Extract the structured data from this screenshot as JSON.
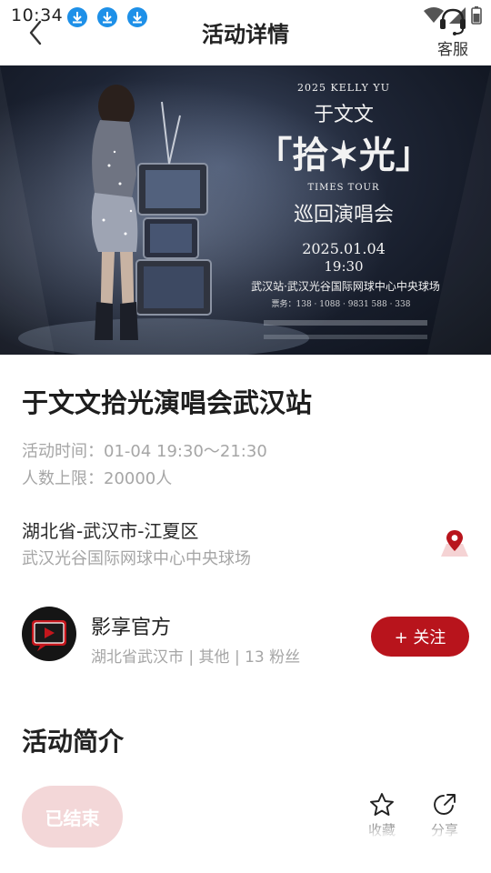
{
  "status_bar": {
    "time": "10:34"
  },
  "header": {
    "title": "活动详情",
    "service_label": "客服"
  },
  "poster": {
    "line1": "2025 KELLY YU",
    "line2": "于文文",
    "line3": "「拾✶光」",
    "line4": "TIMES TOUR",
    "line5": "巡回演唱会",
    "date": "2025.01.04",
    "time": "19:30",
    "venue": "武汉站·武汉光谷国际网球中心中央球场",
    "hotline": "票务：138 · 1088 · 9831 588 · 338"
  },
  "event": {
    "title": "于文文拾光演唱会武汉站",
    "time_line": "活动时间：01-04 19:30～21:30",
    "limit_line": "人数上限：20000人",
    "region": "湖北省-武汉市-江夏区",
    "venue": "武汉光谷国际网球中心中央球场"
  },
  "organizer": {
    "name": "影享官方",
    "meta": "湖北省武汉市 | 其他 | 13 粉丝",
    "follow_label": "+ 关注"
  },
  "intro": {
    "title": "活动简介"
  },
  "bottom_bar": {
    "status_label": "已结束",
    "favorite_label": "收藏",
    "share_label": "分享"
  },
  "colors": {
    "brand": "#b8141c",
    "ended": "#f3d7d8",
    "download_icon": "#1e90e8"
  }
}
